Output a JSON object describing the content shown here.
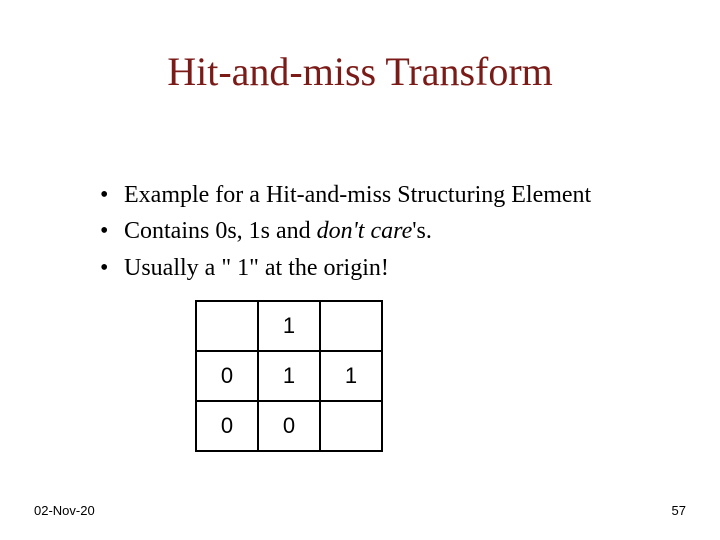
{
  "title": "Hit-and-miss Transform",
  "bullets": [
    {
      "plain": "Example for a Hit-and-miss Structuring Element"
    },
    {
      "prefix": "Contains 0s, 1s and ",
      "italic": "don't care",
      "suffix": "'s."
    },
    {
      "plain": "Usually a \" 1\" at the origin!"
    }
  ],
  "grid": [
    [
      "",
      "1",
      ""
    ],
    [
      "0",
      "1",
      "1"
    ],
    [
      "0",
      "0",
      ""
    ]
  ],
  "footer": {
    "date": "02-Nov-20",
    "page": "57"
  }
}
